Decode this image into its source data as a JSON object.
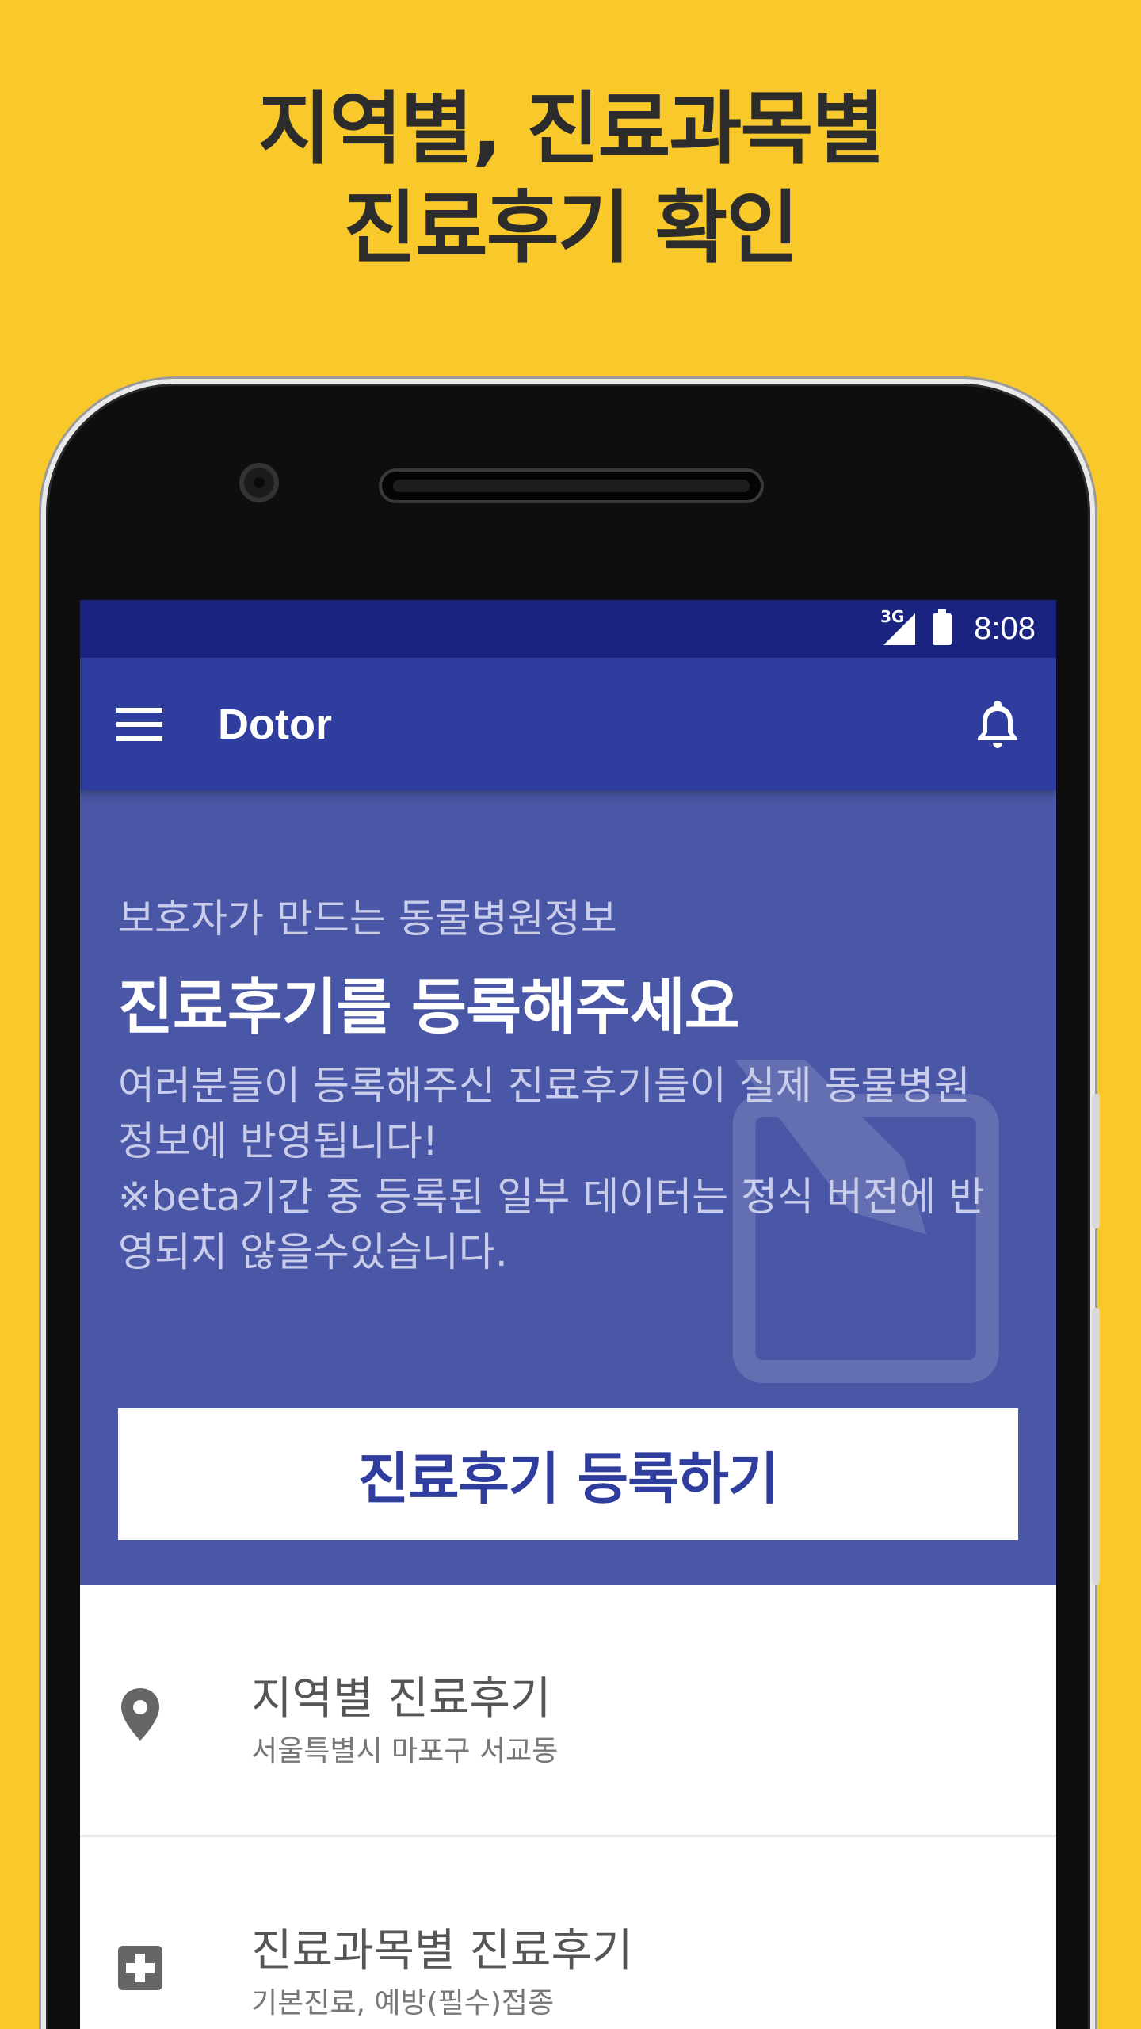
{
  "promo": {
    "headline_line1": "지역별, 진료과목별",
    "headline_line2": "진료후기 확인",
    "background_color": "#f9c92c"
  },
  "status_bar": {
    "network_label": "3G",
    "time": "8:08",
    "icons": [
      "signal-icon",
      "battery-icon"
    ]
  },
  "app_bar": {
    "title": "Dotor",
    "menu_icon": "hamburger-menu-icon",
    "notification_icon": "bell-icon",
    "color": "#2f3e9e"
  },
  "hero": {
    "subtitle": "보호자가 만드는 동물병원정보",
    "title": "진료후기를 등록해주세요",
    "description_line1": "여러분들이 등록해주신 진료후기들이 실제 동물병원",
    "description_line2": "정보에 반영됩니다!",
    "description_line3": "※beta기간 중 등록된 일부 데이터는 정식 버전에 반",
    "description_line4": "영되지 않을수있습니다.",
    "background_icon": "edit-icon",
    "cta_label": "진료후기 등록하기",
    "color": "#4a57a6"
  },
  "list": {
    "items": [
      {
        "icon": "location-pin-icon",
        "title": "지역별 진료후기",
        "subtitle": "서울특별시 마포구 서교동"
      },
      {
        "icon": "medical-cross-icon",
        "title": "진료과목별 진료후기",
        "subtitle": "기본진료, 예방(필수)접종"
      }
    ]
  }
}
